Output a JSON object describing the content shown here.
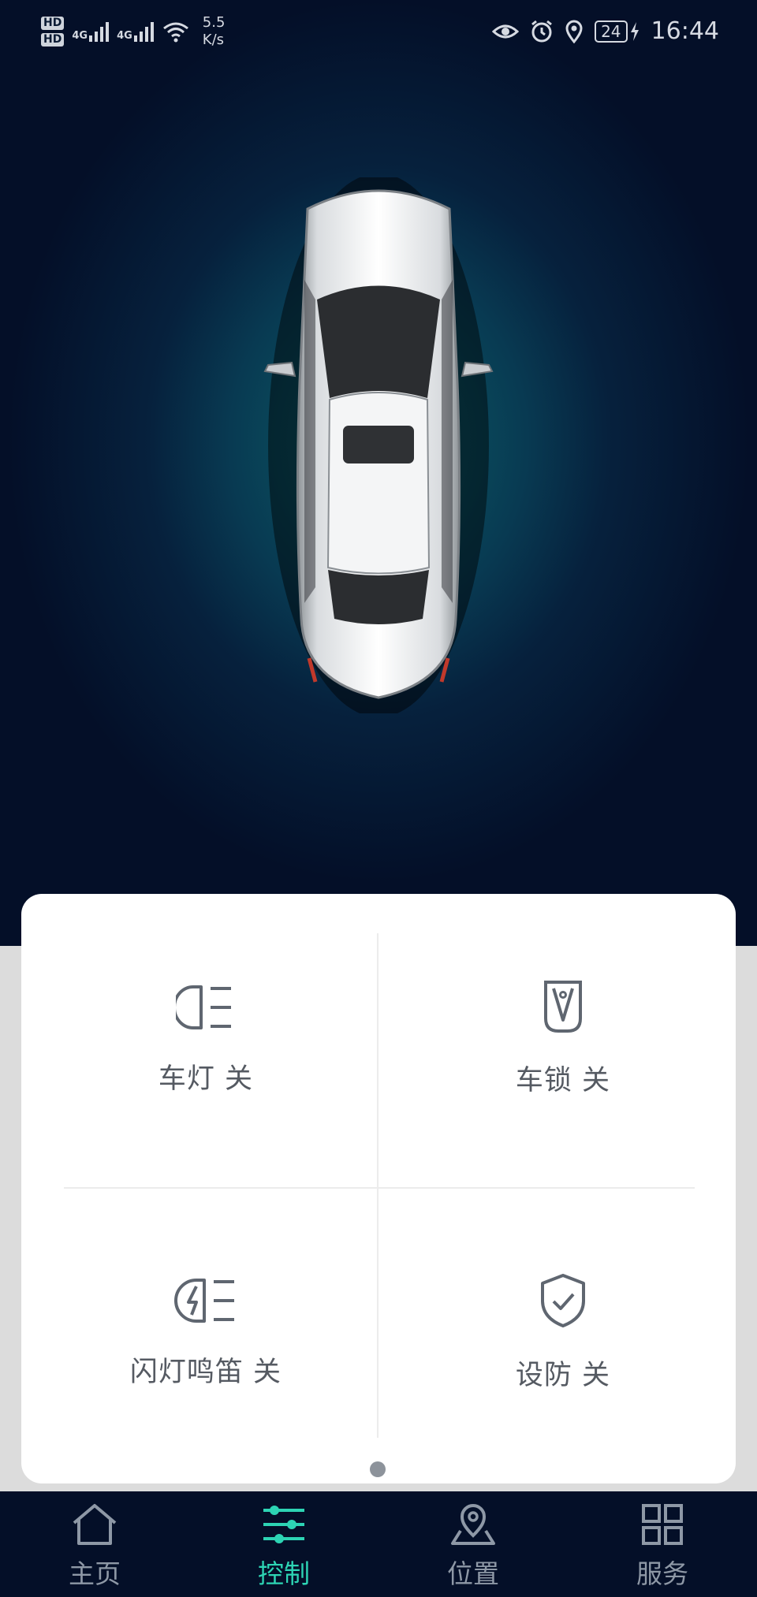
{
  "status_bar": {
    "sim1": "HD",
    "sim2": "HD",
    "net1": "4G",
    "net2": "4G",
    "speed_value": "5.5",
    "speed_unit": "K/s",
    "battery": "24",
    "time": "16:44",
    "icons": [
      "eye-icon",
      "alarm-icon",
      "location-icon",
      "battery-icon",
      "charging-icon"
    ]
  },
  "controls": [
    {
      "icon": "headlight-icon",
      "label": "车灯 关"
    },
    {
      "icon": "car-lock-icon",
      "label": "车锁 关"
    },
    {
      "icon": "flash-horn-icon",
      "label": "闪灯鸣笛 关"
    },
    {
      "icon": "shield-check-icon",
      "label": "设防 关"
    }
  ],
  "nav": [
    {
      "icon": "home-icon",
      "label": "主页",
      "active": false
    },
    {
      "icon": "sliders-icon",
      "label": "控制",
      "active": true
    },
    {
      "icon": "location-pin-icon",
      "label": "位置",
      "active": false
    },
    {
      "icon": "grid-icon",
      "label": "服务",
      "active": false
    }
  ],
  "colors": {
    "accent": "#2dd4b4",
    "nav_bg": "#040f28",
    "hero_glow": "#0f5f6f",
    "icon_gray": "#5f6670"
  },
  "page_indicator": {
    "current": 1,
    "total": 1
  }
}
